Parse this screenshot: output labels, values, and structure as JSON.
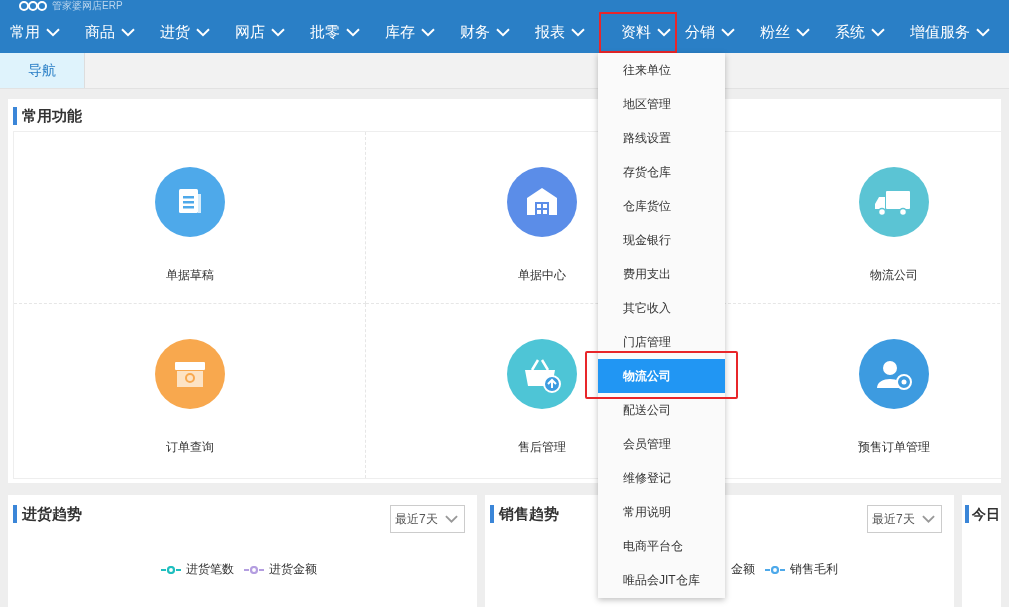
{
  "app": {
    "title": "管家婆网店ERP"
  },
  "nav": [
    {
      "label": "常用",
      "highlighted": false
    },
    {
      "label": "商品",
      "highlighted": false
    },
    {
      "label": "进货",
      "highlighted": false
    },
    {
      "label": "网店",
      "highlighted": false
    },
    {
      "label": "批零",
      "highlighted": false
    },
    {
      "label": "库存",
      "highlighted": false
    },
    {
      "label": "财务",
      "highlighted": false
    },
    {
      "label": "报表",
      "highlighted": false
    },
    {
      "label": "资料",
      "highlighted": true
    },
    {
      "label": "分销",
      "highlighted": false
    },
    {
      "label": "粉丝",
      "highlighted": false
    },
    {
      "label": "系统",
      "highlighted": false
    },
    {
      "label": "增值服务",
      "highlighted": false
    }
  ],
  "tabs": [
    {
      "label": "导航",
      "selected": true
    }
  ],
  "common_functions": {
    "title": "常用功能",
    "items": [
      {
        "label": "单据草稿",
        "kind": "document",
        "color": "#4ea9ea"
      },
      {
        "label": "单据中心",
        "kind": "warehouse",
        "color": "#5b8de8"
      },
      {
        "label": "物流公司",
        "kind": "truck",
        "color": "#5bc4d4"
      },
      {
        "label": "订单查询",
        "kind": "box",
        "color": "#f8a84e"
      },
      {
        "label": "售后管理",
        "kind": "basket",
        "color": "#4ec5d6"
      },
      {
        "label": "预售订单管理",
        "kind": "person",
        "color": "#3d9be0"
      }
    ]
  },
  "cards": [
    {
      "title": "进货趋势",
      "range": "最近7天",
      "legend": [
        {
          "label": "进货笔数",
          "color": "#1fbfbf",
          "kind": "marker"
        },
        {
          "label": "进货金额",
          "color": "#b49ee0",
          "kind": "marker"
        }
      ]
    },
    {
      "title": "销售趋势",
      "range": "最近7天",
      "legend": [
        {
          "label": "金额",
          "kind": "text-only"
        },
        {
          "label": "销售毛利",
          "color": "#4ea9ea",
          "kind": "marker"
        }
      ]
    },
    {
      "title": "今日"
    }
  ],
  "dropdown": {
    "items": [
      {
        "label": "往来单位",
        "selected": false,
        "highlighted": false
      },
      {
        "label": "地区管理",
        "selected": false,
        "highlighted": false
      },
      {
        "label": "路线设置",
        "selected": false,
        "highlighted": false
      },
      {
        "label": "存货仓库",
        "selected": false,
        "highlighted": false
      },
      {
        "label": "仓库货位",
        "selected": false,
        "highlighted": false
      },
      {
        "label": "现金银行",
        "selected": false,
        "highlighted": false
      },
      {
        "label": "费用支出",
        "selected": false,
        "highlighted": false
      },
      {
        "label": "其它收入",
        "selected": false,
        "highlighted": false
      },
      {
        "label": "门店管理",
        "selected": false,
        "highlighted": false
      },
      {
        "label": "物流公司",
        "selected": true,
        "highlighted": true
      },
      {
        "label": "配送公司",
        "selected": false,
        "highlighted": false
      },
      {
        "label": "会员管理",
        "selected": false,
        "highlighted": false
      },
      {
        "label": "维修登记",
        "selected": false,
        "highlighted": false
      },
      {
        "label": "常用说明",
        "selected": false,
        "highlighted": false
      },
      {
        "label": "电商平台仓",
        "selected": false,
        "highlighted": false
      },
      {
        "label": "唯品会JIT仓库",
        "selected": false,
        "highlighted": false
      }
    ]
  }
}
